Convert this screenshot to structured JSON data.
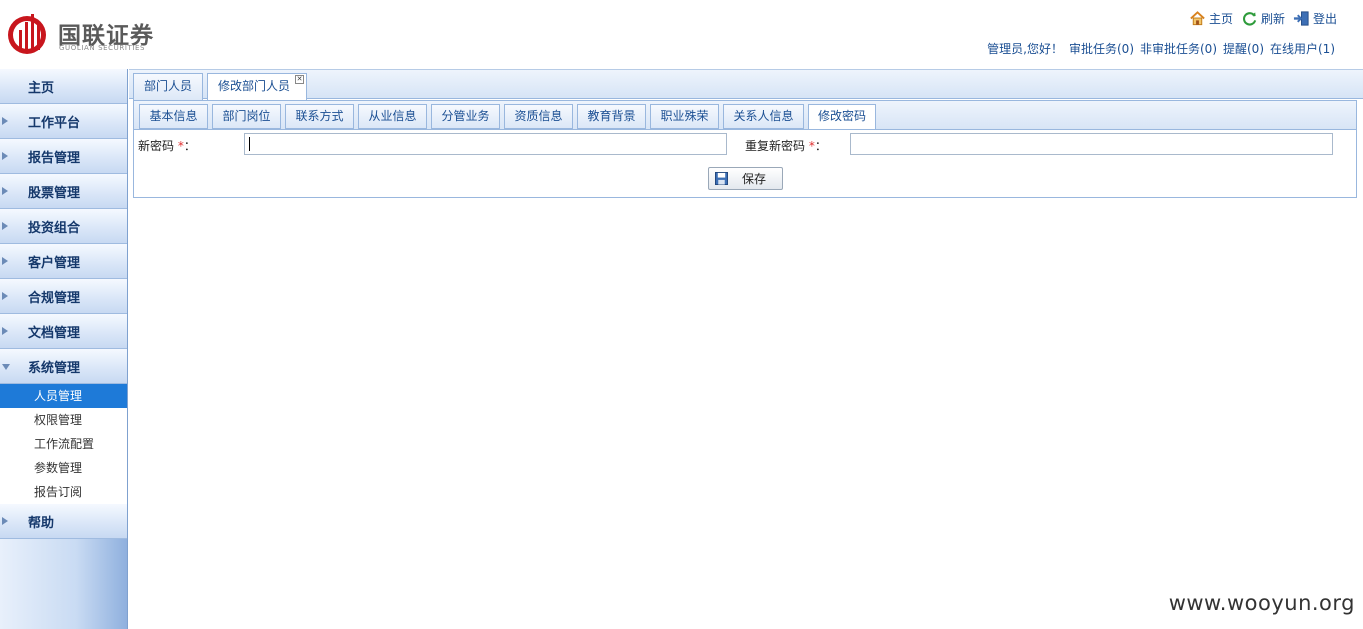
{
  "header": {
    "logo_cn": "国联证券",
    "logo_en": "GUOLIAN SECURITIES",
    "links": [
      {
        "label": "主页",
        "icon": "home-icon"
      },
      {
        "label": "刷新",
        "icon": "refresh-icon"
      },
      {
        "label": "登出",
        "icon": "logout-icon"
      }
    ],
    "user_bar": {
      "greeting": "管理员,您好！",
      "approval_tasks": "审批任务(0)",
      "non_approval_tasks": "非审批任务(0)",
      "reminders": "提醒(0)",
      "online_users": "在线用户(1)"
    }
  },
  "sidebar": {
    "items": [
      {
        "label": "主页"
      },
      {
        "label": "工作平台"
      },
      {
        "label": "报告管理"
      },
      {
        "label": "股票管理"
      },
      {
        "label": "投资组合"
      },
      {
        "label": "客户管理"
      },
      {
        "label": "合规管理"
      },
      {
        "label": "文档管理"
      },
      {
        "label": "系统管理"
      },
      {
        "label": "帮助"
      }
    ],
    "system_submenu": [
      {
        "label": "人员管理"
      },
      {
        "label": "权限管理"
      },
      {
        "label": "工作流配置"
      },
      {
        "label": "参数管理"
      },
      {
        "label": "报告订阅"
      }
    ]
  },
  "main": {
    "outer_tabs": [
      {
        "label": "部门人员"
      },
      {
        "label": "修改部门人员"
      }
    ],
    "inner_tabs": [
      {
        "label": "基本信息"
      },
      {
        "label": "部门岗位"
      },
      {
        "label": "联系方式"
      },
      {
        "label": "从业信息"
      },
      {
        "label": "分管业务"
      },
      {
        "label": "资质信息"
      },
      {
        "label": "教育背景"
      },
      {
        "label": "职业殊荣"
      },
      {
        "label": "关系人信息"
      },
      {
        "label": "修改密码"
      }
    ],
    "form": {
      "new_password_label": "新密码",
      "repeat_password_label": "重复新密码",
      "required_mark": "*",
      "colon": "：",
      "new_password_value": "",
      "repeat_password_value": "",
      "save_label": "保存"
    }
  },
  "watermark": "www.wooyun.org",
  "colors": {
    "accent": "#1b4f93",
    "active_menu": "#1e7ad8",
    "logo_red": "#c8161d"
  }
}
